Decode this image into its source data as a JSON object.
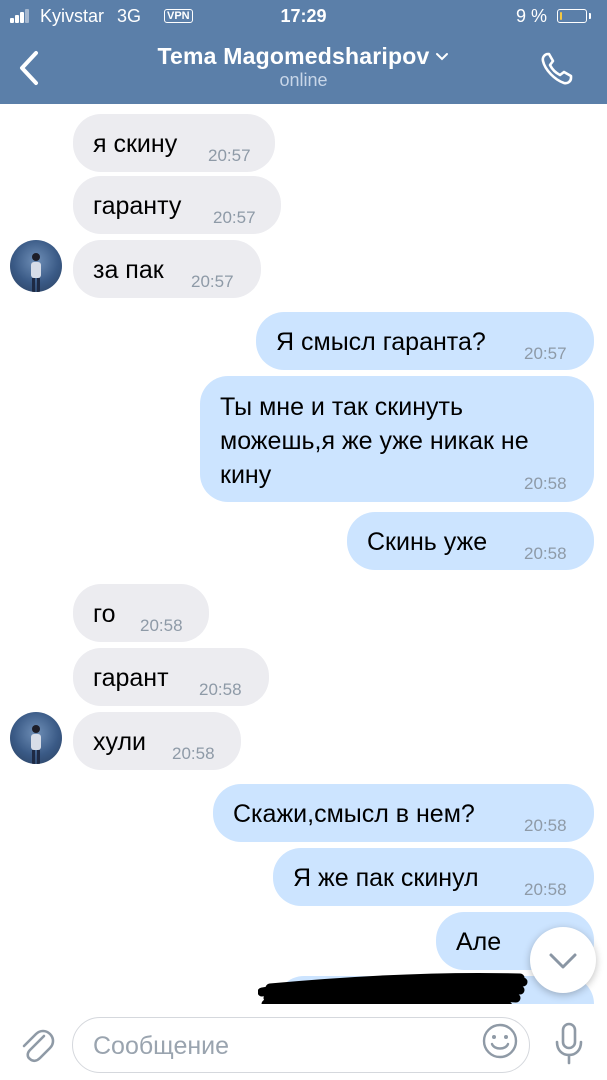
{
  "status_bar": {
    "carrier": "Kyivstar",
    "network": "3G",
    "vpn": "VPN",
    "time": "17:29",
    "battery": "9 %",
    "battery_level": 0.09
  },
  "header": {
    "title": "Tema Magomedsharipov",
    "subtitle": "online",
    "title_chevron_icon": "chevron-down-icon",
    "back_icon": "chevron-left-icon",
    "call_icon": "phone-icon",
    "background_color": "#5b7fa9"
  },
  "messages": [
    {
      "direction": "in",
      "text": "я скину",
      "time": "20:57"
    },
    {
      "direction": "in",
      "text": "гаранту",
      "time": "20:57"
    },
    {
      "direction": "in",
      "text": "за пак",
      "time": "20:57"
    },
    {
      "direction": "out",
      "text": "Я смысл гаранта?",
      "time": "20:57"
    },
    {
      "direction": "out",
      "text": "Ты мне и так скинуть\nможешь,я же уже никак не\nкину",
      "time": "20:58"
    },
    {
      "direction": "out",
      "text": "Скинь уже",
      "time": "20:58"
    },
    {
      "direction": "in",
      "text": "го",
      "time": "20:58"
    },
    {
      "direction": "in",
      "text": "гарант",
      "time": "20:58"
    },
    {
      "direction": "in",
      "text": "хули",
      "time": "20:58"
    },
    {
      "direction": "out",
      "text": "Скажи,смысл в нем?",
      "time": "20:58"
    },
    {
      "direction": "out",
      "text": "Я же пак скинул",
      "time": "20:58"
    },
    {
      "direction": "out",
      "text": "Але",
      "time": ""
    }
  ],
  "composer": {
    "placeholder": "Сообщение",
    "attach_icon": "paperclip-icon",
    "emoji_icon": "smiley-icon",
    "mic_icon": "microphone-icon"
  },
  "colors": {
    "incoming_bubble": "#ececf0",
    "outgoing_bubble": "#cce4ff",
    "time_text": "#8e9aa7"
  }
}
